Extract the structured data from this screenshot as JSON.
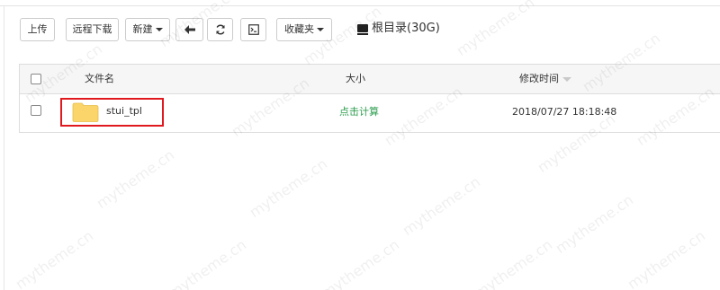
{
  "toolbar": {
    "upload_label": "上传",
    "remote_download_label": "远程下载",
    "new_label": "新建",
    "favorites_label": "收藏夹"
  },
  "storage": {
    "label": "根目录(30G)"
  },
  "table": {
    "columns": {
      "name": "文件名",
      "size": "大小",
      "modified": "修改时间"
    },
    "rows": [
      {
        "name": "stui_tpl",
        "size": "点击计算",
        "modified": "2018/07/27 18:18:48"
      }
    ]
  },
  "watermark_text": "mytheme.cn",
  "colors": {
    "highlight_border": "#e0191e",
    "calc_link": "#2e9e4f",
    "folder": "#fbd56a"
  }
}
